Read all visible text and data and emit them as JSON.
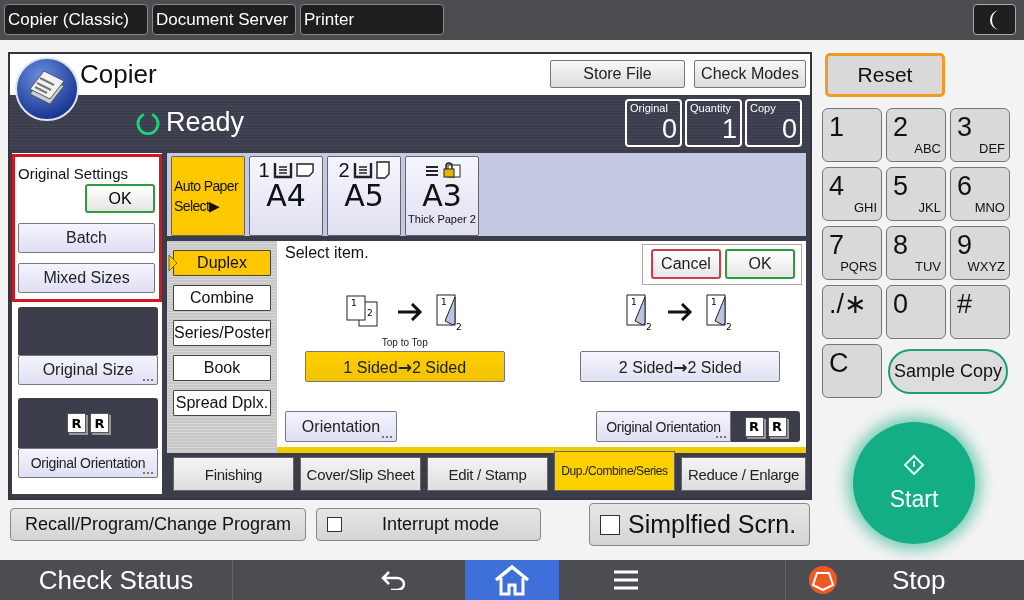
{
  "mode_tabs": [
    "Copier (Classic)",
    "Document Server",
    "Printer"
  ],
  "copier": {
    "title": "Copier",
    "actions": [
      "Store File",
      "Check Modes"
    ],
    "status": "Ready",
    "counters": [
      {
        "label": "Original",
        "value": "0"
      },
      {
        "label": "Quantity",
        "value": "1"
      },
      {
        "label": "Copy",
        "value": "0"
      }
    ]
  },
  "original_settings": {
    "title": "Original Settings",
    "confirm": "OK",
    "options": [
      "Batch",
      "Mixed Sizes"
    ]
  },
  "original_size": {
    "label": "Original Size"
  },
  "original_orientation": {
    "label": "Original Orientation",
    "marks": [
      "R",
      "R"
    ]
  },
  "paper_trays": [
    {
      "kind": "auto",
      "lines": [
        "Auto Paper",
        "Select▶"
      ],
      "selected": true
    },
    {
      "kind": "tray",
      "number": "1",
      "size": "A4",
      "landscape": true,
      "selected": false
    },
    {
      "kind": "tray",
      "number": "2",
      "size": "A5",
      "landscape": false,
      "selected": false
    },
    {
      "kind": "bypass",
      "size": "A3",
      "note": "Thick Paper 2",
      "selected": false
    }
  ],
  "function_tabs": [
    {
      "label": "Duplex",
      "selected": true
    },
    {
      "label": "Combine",
      "selected": false
    },
    {
      "label": "Series/Poster",
      "selected": false
    },
    {
      "label": "Book",
      "selected": false
    },
    {
      "label": "Spread Dplx.",
      "selected": false
    }
  ],
  "prompt": "Select item.",
  "dialog": [
    {
      "kind": "cancel",
      "label": "Cancel"
    },
    {
      "kind": "ok",
      "label": "OK"
    }
  ],
  "duplex_options": [
    {
      "label": "1 Sided**→**2 Sided",
      "selected": true,
      "caption": "Top to Top",
      "from": {
        "kind": "sheets",
        "marks": [
          "1",
          "2"
        ]
      },
      "to": {
        "kind": "duplex",
        "marks": [
          "1",
          "2"
        ]
      }
    },
    {
      "label": "2 Sided**→**2 Sided",
      "selected": false,
      "from": {
        "kind": "duplex",
        "marks": [
          "1",
          "2"
        ]
      },
      "to": {
        "kind": "duplex",
        "marks": [
          "1",
          "2"
        ]
      }
    }
  ],
  "orientation_button": "Orientation",
  "original_orientation_button": {
    "label": "Original Orientation",
    "marks": [
      "R",
      "R"
    ]
  },
  "bottom_tabs": [
    {
      "label": "Finishing",
      "selected": false
    },
    {
      "label": "Cover/Slip Sheet",
      "selected": false
    },
    {
      "label": "Edit / Stamp",
      "selected": false
    },
    {
      "label": "Dup./Combine/Series",
      "selected": true
    },
    {
      "label": "Reduce / Enlarge",
      "selected": false
    }
  ],
  "footer": {
    "recall": "Recall/Program/Change Program",
    "interrupt": {
      "label": "Interrupt mode",
      "checked": false
    },
    "simplified": {
      "label": "Simplfied Scrn.",
      "checked": false
    }
  },
  "keypad": {
    "reset": "Reset",
    "keys": [
      {
        "digit": "1"
      },
      {
        "digit": "2",
        "letters": "ABC"
      },
      {
        "digit": "3",
        "letters": "DEF"
      },
      {
        "digit": "4",
        "letters": "GHI"
      },
      {
        "digit": "5",
        "letters": "JKL"
      },
      {
        "digit": "6",
        "letters": "MNO"
      },
      {
        "digit": "7",
        "letters": "PQRS"
      },
      {
        "digit": "8",
        "letters": "TUV"
      },
      {
        "digit": "9",
        "letters": "WXYZ"
      },
      {
        "digit": "./∗"
      },
      {
        "digit": "0"
      },
      {
        "digit": "#"
      },
      {
        "digit": "C"
      }
    ],
    "sample_copy": "Sample Copy",
    "start": "Start"
  },
  "nav_bar": {
    "check_status": "Check Status",
    "items": [
      {
        "kind": "back",
        "selected": false
      },
      {
        "kind": "home",
        "selected": true
      },
      {
        "kind": "menu",
        "selected": false
      }
    ],
    "stop": "Stop"
  }
}
